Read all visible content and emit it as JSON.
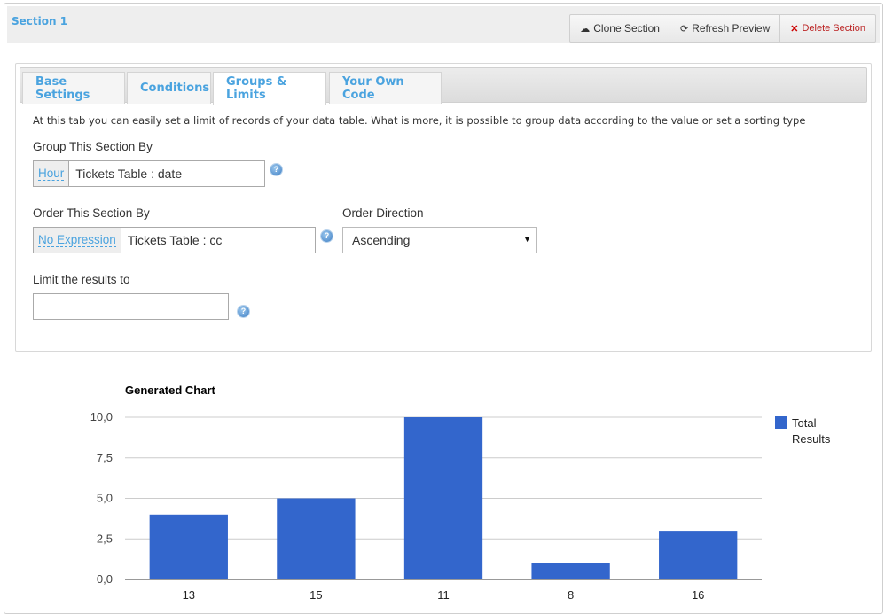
{
  "section": {
    "title": "Section 1",
    "buttons": {
      "clone": {
        "label": "Clone Section",
        "icon": "cloud-icon"
      },
      "refresh": {
        "label": "Refresh Preview",
        "icon": "refresh-icon"
      },
      "delete": {
        "label": "Delete Section",
        "icon": "close-icon"
      }
    }
  },
  "tabs": [
    {
      "label": "Base Settings",
      "active": false
    },
    {
      "label": "Conditions",
      "active": false
    },
    {
      "label": "Groups & Limits",
      "active": true
    },
    {
      "label": "Your Own Code",
      "active": false
    }
  ],
  "description": "At this tab you can easily set a limit of records of your data table. What is more, it is possible to group data according to the value or set a sorting type",
  "group_by": {
    "label": "Group This Section By",
    "expression": "Hour",
    "value": "Tickets Table : date"
  },
  "order_by": {
    "label": "Order This Section By",
    "expression": "No Expression",
    "value": "Tickets Table : cc"
  },
  "order_direction": {
    "label": "Order Direction",
    "selected": "Ascending"
  },
  "limit": {
    "label": "Limit the results to",
    "value": ""
  },
  "help_glyph": "?",
  "colors": {
    "accent": "#4aa3df",
    "bar": "#3366cc",
    "delete": "#cc0000"
  },
  "chart_data": {
    "type": "bar",
    "title": "Generated Chart",
    "categories": [
      "13",
      "15",
      "11",
      "8",
      "16"
    ],
    "series": [
      {
        "name": "Total Results",
        "values": [
          4,
          5,
          10,
          1,
          3
        ],
        "color": "#3366cc"
      }
    ],
    "yticks": [
      "0,0",
      "2,5",
      "5,0",
      "7,5",
      "10,0"
    ],
    "ytick_values": [
      0,
      2.5,
      5,
      7.5,
      10
    ],
    "ylim": [
      0,
      10
    ],
    "xlabel": "",
    "ylabel": "",
    "grid": true,
    "legend": "right",
    "legend_lines": [
      "Total",
      "Results"
    ]
  }
}
